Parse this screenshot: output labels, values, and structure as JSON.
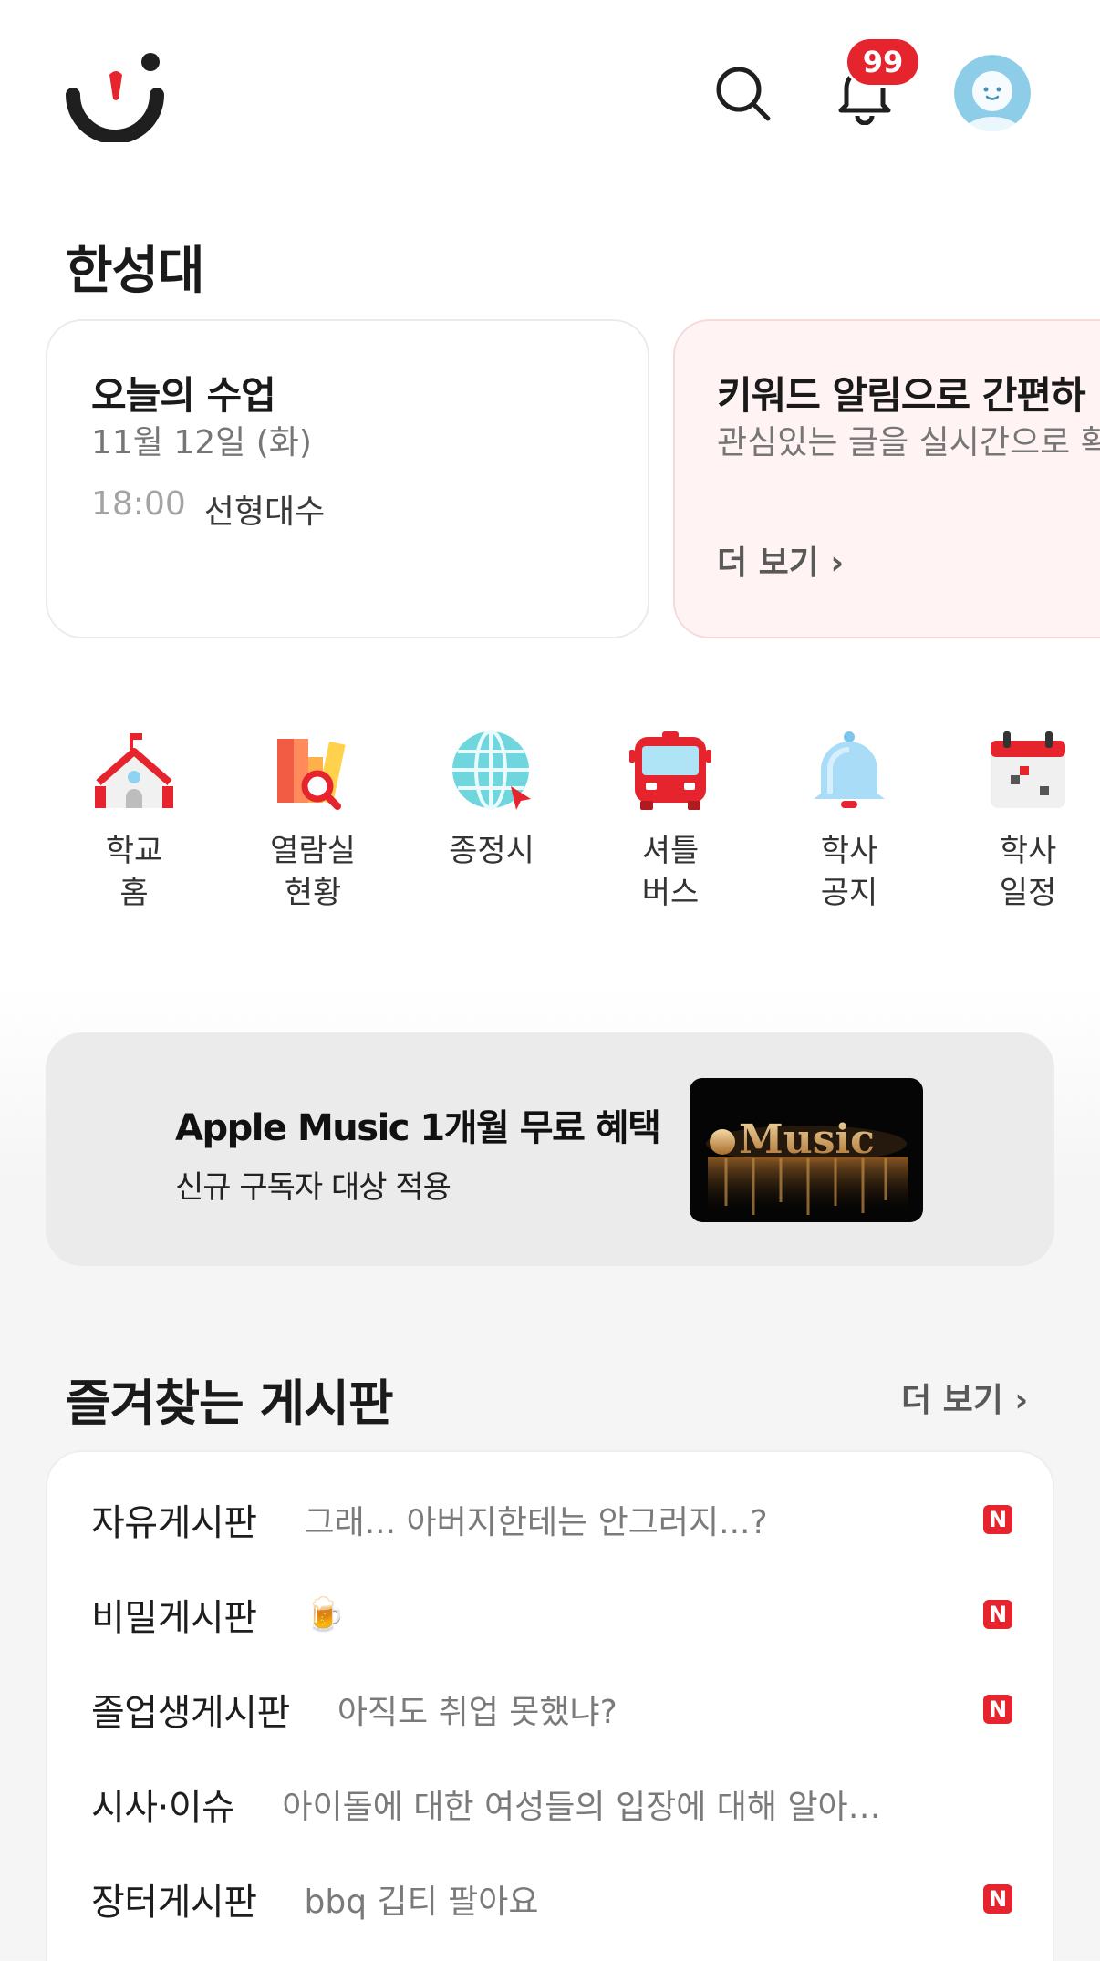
{
  "header": {
    "notification_count": "99",
    "brand_color": "#e5242d"
  },
  "school_name": "한성대",
  "cards": {
    "today_class": {
      "title": "오늘의 수업",
      "date": "11월 12일 (화)",
      "time": "18:00",
      "course": "선형대수"
    },
    "keyword_alert": {
      "title": "키워드 알림으로 간편하",
      "subtitle": "관심있는 글을 실시간으로 확",
      "more": "더 보기 ›"
    }
  },
  "quick_menu": [
    {
      "label": "학교\n홈",
      "icon": "school-icon"
    },
    {
      "label": "열람실\n현황",
      "icon": "library-icon"
    },
    {
      "label": "종정시",
      "icon": "globe-icon"
    },
    {
      "label": "셔틀\n버스",
      "icon": "bus-icon"
    },
    {
      "label": "학사\n공지",
      "icon": "bell-icon"
    },
    {
      "label": "학사\n일정",
      "icon": "calendar-icon"
    }
  ],
  "banner": {
    "title": "Apple Music 1개월 무료 혜택",
    "subtitle": "신규 구독자 대상 적용",
    "image_text": "Music"
  },
  "favorites": {
    "title": "즐겨찾는 게시판",
    "more": "더 보기 ›",
    "boards": [
      {
        "name": "자유게시판",
        "preview": "그래... 아버지한테는 안그러지...?",
        "new": "N"
      },
      {
        "name": "비밀게시판",
        "preview": "🍺",
        "new": "N"
      },
      {
        "name": "졸업생게시판",
        "preview": "아직도 취업 못했냐?",
        "new": "N"
      },
      {
        "name": "시사·이슈",
        "preview": "아이돌에 대한 여성들의 입장에 대해 알아…",
        "new": ""
      },
      {
        "name": "장터게시판",
        "preview": "bbq 깁티 팔아요",
        "new": "N"
      }
    ]
  }
}
